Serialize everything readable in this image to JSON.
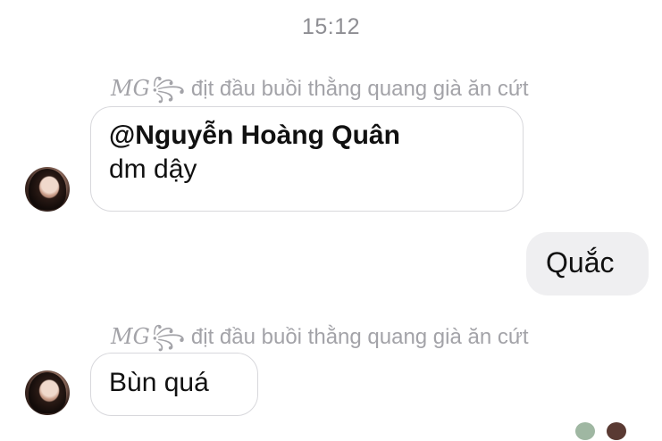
{
  "timestamp": "15:12",
  "messages": [
    {
      "sender_prefix": "MG",
      "sender_suffix": "꧂ địt đầu buồi thằng quang già ăn cứt",
      "mention": "@Nguyễn Hoàng Quân",
      "text": "dm dậy"
    },
    {
      "text": "Quắc"
    },
    {
      "sender_prefix": "MG",
      "sender_suffix": "꧂ địt đầu buồi thằng quang già ăn cứt",
      "text": "Bùn quá"
    }
  ],
  "colors": {
    "incoming_bubble_border": "#d8d8dc",
    "outgoing_bubble_bg": "#efeff1",
    "meta_text": "#8e8e93"
  }
}
